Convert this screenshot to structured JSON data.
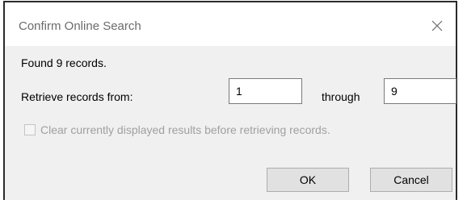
{
  "window": {
    "title": "Confirm Online Search",
    "close_icon": "close-icon"
  },
  "body": {
    "found_text": "Found 9 records.",
    "retrieve_label": "Retrieve records from:",
    "from_value": "1",
    "through_label": "through",
    "to_value": "9",
    "clear_checkbox_label": "Clear currently displayed results before retrieving records.",
    "clear_checkbox_checked": false,
    "clear_checkbox_enabled": false
  },
  "buttons": {
    "ok_label": "OK",
    "cancel_label": "Cancel"
  },
  "colors": {
    "dialog_bg": "#f0f0f0",
    "title_color": "#6b6b6b",
    "disabled_text": "#a0a0a0",
    "button_bg": "#e1e1e1"
  }
}
